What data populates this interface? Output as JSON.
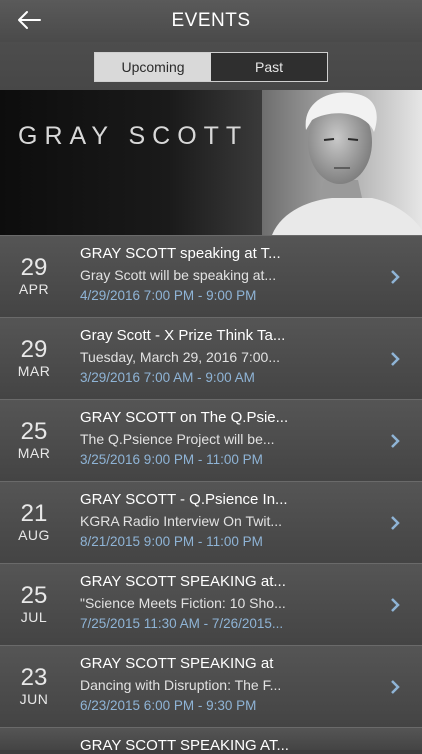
{
  "header": {
    "title": "EVENTS"
  },
  "tabs": [
    {
      "label": "Upcoming"
    },
    {
      "label": "Past"
    }
  ],
  "banner": {
    "name": "GRAY SCOTT"
  },
  "events": [
    {
      "day": "29",
      "month": "APR",
      "title": "GRAY SCOTT speaking at T...",
      "desc": "Gray Scott will be speaking at...",
      "time": "4/29/2016 7:00 PM - 9:00 PM"
    },
    {
      "day": "29",
      "month": "MAR",
      "title": "Gray Scott - X Prize Think Ta...",
      "desc": "Tuesday, March 29, 2016 7:00...",
      "time": "3/29/2016 7:00 AM - 9:00 AM"
    },
    {
      "day": "25",
      "month": "MAR",
      "title": "GRAY SCOTT on The Q.Psie...",
      "desc": "The Q.Psience Project will be...",
      "time": "3/25/2016 9:00 PM - 11:00 PM"
    },
    {
      "day": "21",
      "month": "AUG",
      "title": "GRAY SCOTT - Q.Psience In...",
      "desc": "KGRA Radio Interview  On Twit...",
      "time": "8/21/2015 9:00 PM - 11:00 PM"
    },
    {
      "day": "25",
      "month": "JUL",
      "title": "GRAY SCOTT SPEAKING at...",
      "desc": "\"Science Meets Fiction: 10 Sho...",
      "time": "7/25/2015 11:30 AM - 7/26/2015..."
    },
    {
      "day": "23",
      "month": "JUN",
      "title": "GRAY SCOTT SPEAKING at",
      "desc": "Dancing with Disruption: The F...",
      "time": "6/23/2015 6:00 PM - 9:30 PM"
    },
    {
      "day": "",
      "month": "",
      "title": "GRAY SCOTT SPEAKING AT...",
      "desc": "",
      "time": ""
    }
  ]
}
